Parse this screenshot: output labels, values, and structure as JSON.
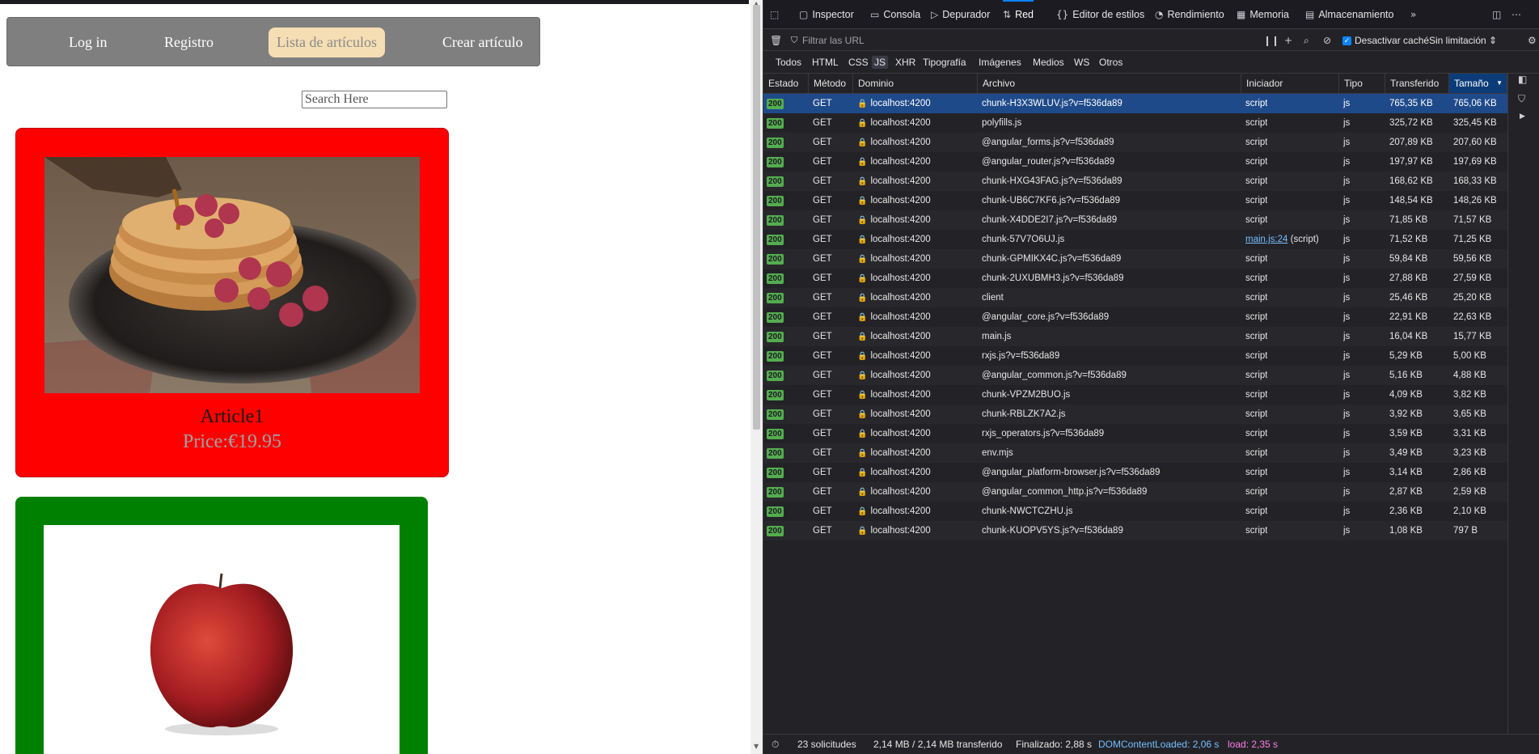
{
  "app": {
    "nav": {
      "login": "Log in",
      "register": "Registro",
      "articles": "Lista de artículos",
      "create": "Crear artículo"
    },
    "search": {
      "placeholder": "Search Here"
    },
    "cards": [
      {
        "title": "Article1",
        "price": "Price:€19.95",
        "color": "#ff0000"
      },
      {
        "title": "",
        "price": "",
        "color": "#008000"
      }
    ]
  },
  "devtools": {
    "tabs": [
      "Inspector",
      "Consola",
      "Depurador",
      "Red",
      "Editor de estilos",
      "Rendimiento",
      "Memoria",
      "Almacenamiento"
    ],
    "active_tab": "Red",
    "toolbar": {
      "filter_placeholder": "Filtrar las URL",
      "disable_cache": "Desactivar caché",
      "throttle": "Sin limitación"
    },
    "filters": [
      "Todos",
      "HTML",
      "CSS",
      "JS",
      "XHR",
      "Tipografía",
      "Imágenes",
      "Medios",
      "WS",
      "Otros"
    ],
    "active_filter": "JS",
    "columns": [
      "Estado",
      "Método",
      "Dominio",
      "Archivo",
      "Iniciador",
      "Tipo",
      "Transferido",
      "Tamaño"
    ],
    "requests": [
      {
        "status": "200",
        "method": "GET",
        "domain": "localhost:4200",
        "file": "chunk-H3X3WLUV.js?v=f536da89",
        "initiator": "script",
        "type": "js",
        "transferred": "765,35 KB",
        "size": "765,06 KB"
      },
      {
        "status": "200",
        "method": "GET",
        "domain": "localhost:4200",
        "file": "polyfills.js",
        "initiator": "script",
        "type": "js",
        "transferred": "325,72 KB",
        "size": "325,45 KB"
      },
      {
        "status": "200",
        "method": "GET",
        "domain": "localhost:4200",
        "file": "@angular_forms.js?v=f536da89",
        "initiator": "script",
        "type": "js",
        "transferred": "207,89 KB",
        "size": "207,60 KB"
      },
      {
        "status": "200",
        "method": "GET",
        "domain": "localhost:4200",
        "file": "@angular_router.js?v=f536da89",
        "initiator": "script",
        "type": "js",
        "transferred": "197,97 KB",
        "size": "197,69 KB"
      },
      {
        "status": "200",
        "method": "GET",
        "domain": "localhost:4200",
        "file": "chunk-HXG43FAG.js?v=f536da89",
        "initiator": "script",
        "type": "js",
        "transferred": "168,62 KB",
        "size": "168,33 KB"
      },
      {
        "status": "200",
        "method": "GET",
        "domain": "localhost:4200",
        "file": "chunk-UB6C7KF6.js?v=f536da89",
        "initiator": "script",
        "type": "js",
        "transferred": "148,54 KB",
        "size": "148,26 KB"
      },
      {
        "status": "200",
        "method": "GET",
        "domain": "localhost:4200",
        "file": "chunk-X4DDE2I7.js?v=f536da89",
        "initiator": "script",
        "type": "js",
        "transferred": "71,85 KB",
        "size": "71,57 KB"
      },
      {
        "status": "200",
        "method": "GET",
        "domain": "localhost:4200",
        "file": "chunk-57V7O6UJ.js",
        "initiator": "main.js:24",
        "initiator_suffix": " (script)",
        "type": "js",
        "transferred": "71,52 KB",
        "size": "71,25 KB"
      },
      {
        "status": "200",
        "method": "GET",
        "domain": "localhost:4200",
        "file": "chunk-GPMIKX4C.js?v=f536da89",
        "initiator": "script",
        "type": "js",
        "transferred": "59,84 KB",
        "size": "59,56 KB"
      },
      {
        "status": "200",
        "method": "GET",
        "domain": "localhost:4200",
        "file": "chunk-2UXUBMH3.js?v=f536da89",
        "initiator": "script",
        "type": "js",
        "transferred": "27,88 KB",
        "size": "27,59 KB"
      },
      {
        "status": "200",
        "method": "GET",
        "domain": "localhost:4200",
        "file": "client",
        "initiator": "script",
        "type": "js",
        "transferred": "25,46 KB",
        "size": "25,20 KB"
      },
      {
        "status": "200",
        "method": "GET",
        "domain": "localhost:4200",
        "file": "@angular_core.js?v=f536da89",
        "initiator": "script",
        "type": "js",
        "transferred": "22,91 KB",
        "size": "22,63 KB"
      },
      {
        "status": "200",
        "method": "GET",
        "domain": "localhost:4200",
        "file": "main.js",
        "initiator": "script",
        "type": "js",
        "transferred": "16,04 KB",
        "size": "15,77 KB"
      },
      {
        "status": "200",
        "method": "GET",
        "domain": "localhost:4200",
        "file": "rxjs.js?v=f536da89",
        "initiator": "script",
        "type": "js",
        "transferred": "5,29 KB",
        "size": "5,00 KB"
      },
      {
        "status": "200",
        "method": "GET",
        "domain": "localhost:4200",
        "file": "@angular_common.js?v=f536da89",
        "initiator": "script",
        "type": "js",
        "transferred": "5,16 KB",
        "size": "4,88 KB"
      },
      {
        "status": "200",
        "method": "GET",
        "domain": "localhost:4200",
        "file": "chunk-VPZM2BUO.js",
        "initiator": "script",
        "type": "js",
        "transferred": "4,09 KB",
        "size": "3,82 KB"
      },
      {
        "status": "200",
        "method": "GET",
        "domain": "localhost:4200",
        "file": "chunk-RBLZK7A2.js",
        "initiator": "script",
        "type": "js",
        "transferred": "3,92 KB",
        "size": "3,65 KB"
      },
      {
        "status": "200",
        "method": "GET",
        "domain": "localhost:4200",
        "file": "rxjs_operators.js?v=f536da89",
        "initiator": "script",
        "type": "js",
        "transferred": "3,59 KB",
        "size": "3,31 KB"
      },
      {
        "status": "200",
        "method": "GET",
        "domain": "localhost:4200",
        "file": "env.mjs",
        "initiator": "script",
        "type": "js",
        "transferred": "3,49 KB",
        "size": "3,23 KB"
      },
      {
        "status": "200",
        "method": "GET",
        "domain": "localhost:4200",
        "file": "@angular_platform-browser.js?v=f536da89",
        "initiator": "script",
        "type": "js",
        "transferred": "3,14 KB",
        "size": "2,86 KB"
      },
      {
        "status": "200",
        "method": "GET",
        "domain": "localhost:4200",
        "file": "@angular_common_http.js?v=f536da89",
        "initiator": "script",
        "type": "js",
        "transferred": "2,87 KB",
        "size": "2,59 KB"
      },
      {
        "status": "200",
        "method": "GET",
        "domain": "localhost:4200",
        "file": "chunk-NWCTCZHU.js",
        "initiator": "script",
        "type": "js",
        "transferred": "2,36 KB",
        "size": "2,10 KB"
      },
      {
        "status": "200",
        "method": "GET",
        "domain": "localhost:4200",
        "file": "chunk-KUOPV5YS.js?v=f536da89",
        "initiator": "script",
        "type": "js",
        "transferred": "1,08 KB",
        "size": "797 B"
      }
    ],
    "status_bar": {
      "requests": "23 solicitudes",
      "transferred": "2,14 MB / 2,14 MB transferido",
      "finished": "Finalizado: 2,88 s",
      "dom_content_loaded": "DOMContentLoaded: 2,06 s",
      "load": "load: 2,35 s"
    },
    "colors": {
      "accent": "#0a84ff",
      "selected_row": "#1f4a8a",
      "status_ok": "#54ad4f",
      "dcl": "#75bfff",
      "load": "#ff7de9"
    }
  }
}
